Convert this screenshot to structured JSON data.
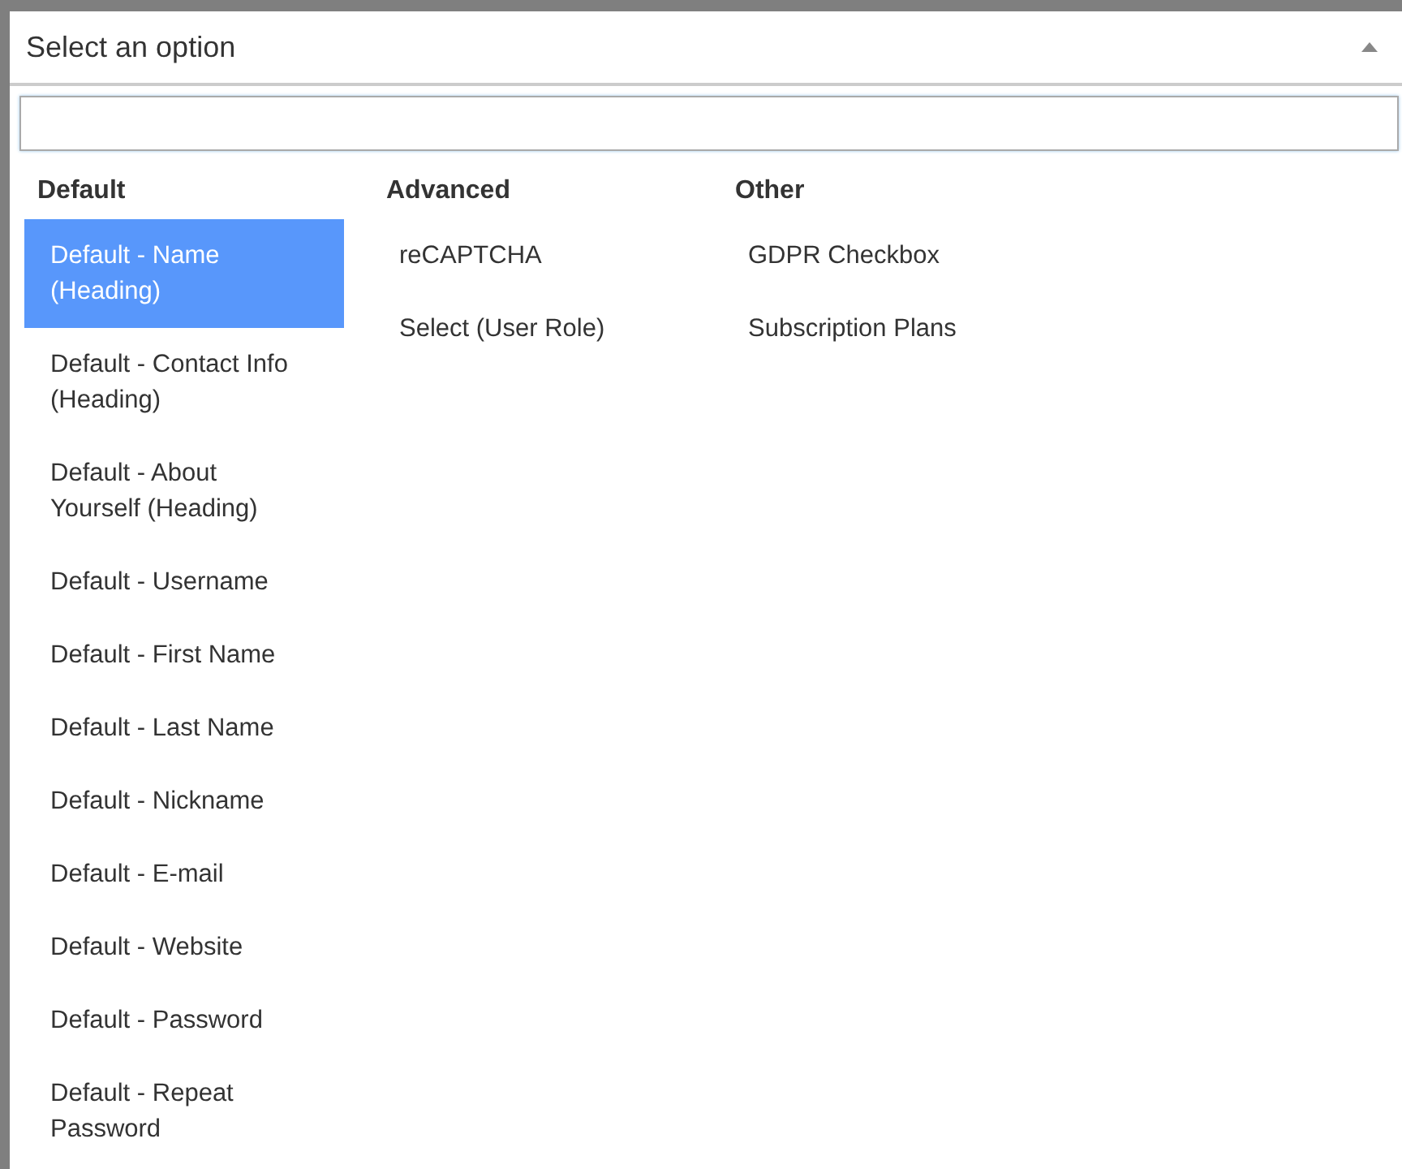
{
  "select": {
    "placeholder": "Select an option",
    "expanded": true
  },
  "groups": [
    {
      "heading": "Default",
      "items": [
        {
          "label": "Default - Name (Heading)",
          "selected": true
        },
        {
          "label": "Default - Contact Info (Heading)",
          "selected": false
        },
        {
          "label": "Default - About Yourself (Heading)",
          "selected": false
        },
        {
          "label": "Default - Username",
          "selected": false
        },
        {
          "label": "Default - First Name",
          "selected": false
        },
        {
          "label": "Default - Last Name",
          "selected": false
        },
        {
          "label": "Default - Nickname",
          "selected": false
        },
        {
          "label": "Default - E-mail",
          "selected": false
        },
        {
          "label": "Default - Website",
          "selected": false
        },
        {
          "label": "Default - Password",
          "selected": false
        },
        {
          "label": "Default - Repeat Password",
          "selected": false
        }
      ]
    },
    {
      "heading": "Advanced",
      "items": [
        {
          "label": "reCAPTCHA",
          "selected": false
        },
        {
          "label": "Select (User Role)",
          "selected": false
        }
      ]
    },
    {
      "heading": "Other",
      "items": [
        {
          "label": "GDPR Checkbox",
          "selected": false
        },
        {
          "label": "Subscription Plans",
          "selected": false
        }
      ]
    }
  ]
}
